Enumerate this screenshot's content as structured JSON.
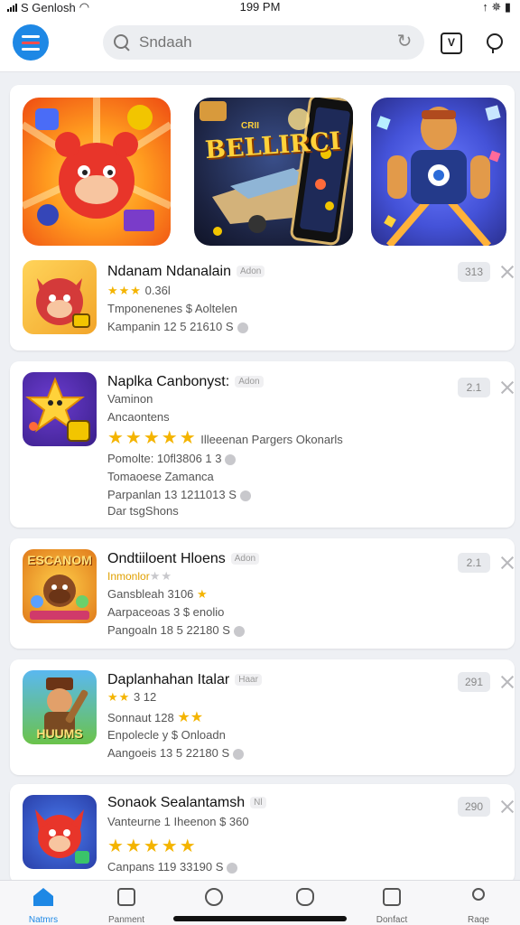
{
  "status_bar": {
    "carrier": "S Genlosh",
    "time": "199 PM",
    "right": "↑ ✵ ▮"
  },
  "header": {
    "search_placeholder": "Sndaah",
    "v_label": "V"
  },
  "featured": {
    "banner_text": "BELLIRCI",
    "banner_sub": "CRII"
  },
  "apps": [
    {
      "name": "Ndanam Ndanalain",
      "badge": "Adon",
      "stars": "★★★",
      "rating_text": "0.36l",
      "line2": "Tmponenenes $ Aoltelen",
      "line3": "Kampanin 12 5 21610 S",
      "rank": "313"
    },
    {
      "name": "Naplka Canbonyst:",
      "badge": "Adon",
      "line1": "Vaminon",
      "line2": "Ancaontens",
      "stars": "★★★★★",
      "rating_text": "Illeeenan Pargers Okonarls",
      "line4": "Pomolte: 10fl3806 1 3",
      "line5": "Tomaoese Zamanca",
      "line6": "Parpanlan 13 1211013 S",
      "line7": "Dar tsgShons",
      "rank": "2.1"
    },
    {
      "name": "Ondtiiloent Hloens",
      "badge": "Adon",
      "stars": "★★",
      "stars_prefix": "Inmonlor",
      "line2": "Gansbleah 3106",
      "line3": "Aarpaceoas 3 $ enolio",
      "line4": "Pangoaln 18 5 22180 S",
      "rank": "2.1",
      "icon_text": "ESCANOM"
    },
    {
      "name": "Daplanhahan Italar",
      "badge": "Haar",
      "stars": "★★",
      "rating_text": "3 12",
      "line2": "Sonnaut 128",
      "line3": "Enpolecle y $ Onloadn",
      "line4": "Aangoeis 13 5 22180 S",
      "rank": "291",
      "icon_text": "HUUMS"
    },
    {
      "name": "Sonaok Sealantamsh",
      "badge": "Nl",
      "line1": "Vanteurne 1 Iheenon $ 360",
      "stars": "★★★★★",
      "line3": "Canpans 119 33190 S",
      "rank": "290"
    }
  ],
  "nav": [
    {
      "label": "Natmrs"
    },
    {
      "label": "Panment"
    },
    {
      "label": ""
    },
    {
      "label": ""
    },
    {
      "label": "Donfact"
    },
    {
      "label": "Raqe"
    }
  ],
  "colors": {
    "accent": "#1e88e5",
    "star": "#f4b400"
  }
}
